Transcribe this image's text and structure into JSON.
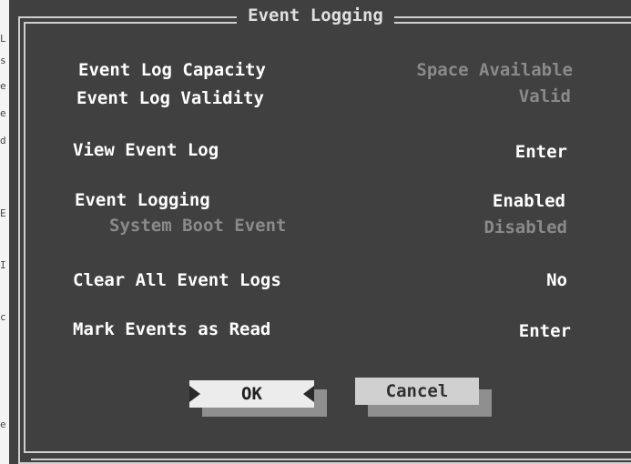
{
  "dialog": {
    "title": "Event Logging"
  },
  "rows": {
    "capacity": {
      "label": "Event Log Capacity",
      "value": "Space Available"
    },
    "validity": {
      "label": "Event Log Validity",
      "value": "Valid"
    },
    "view": {
      "label": "View Event Log",
      "value": "Enter"
    },
    "logging": {
      "label": "Event Logging",
      "value": "Enabled"
    },
    "boot": {
      "label": "System Boot Event",
      "value": "Disabled"
    },
    "clear": {
      "label": "Clear All Event Logs",
      "value": "No"
    },
    "mark": {
      "label": "Mark Events as Read",
      "value": "Enter"
    }
  },
  "buttons": {
    "ok": "OK",
    "cancel": "Cancel"
  },
  "left_strip_glyphs": [
    "L",
    "s",
    "e",
    "e",
    "d",
    "E",
    "I",
    "c",
    "e"
  ]
}
